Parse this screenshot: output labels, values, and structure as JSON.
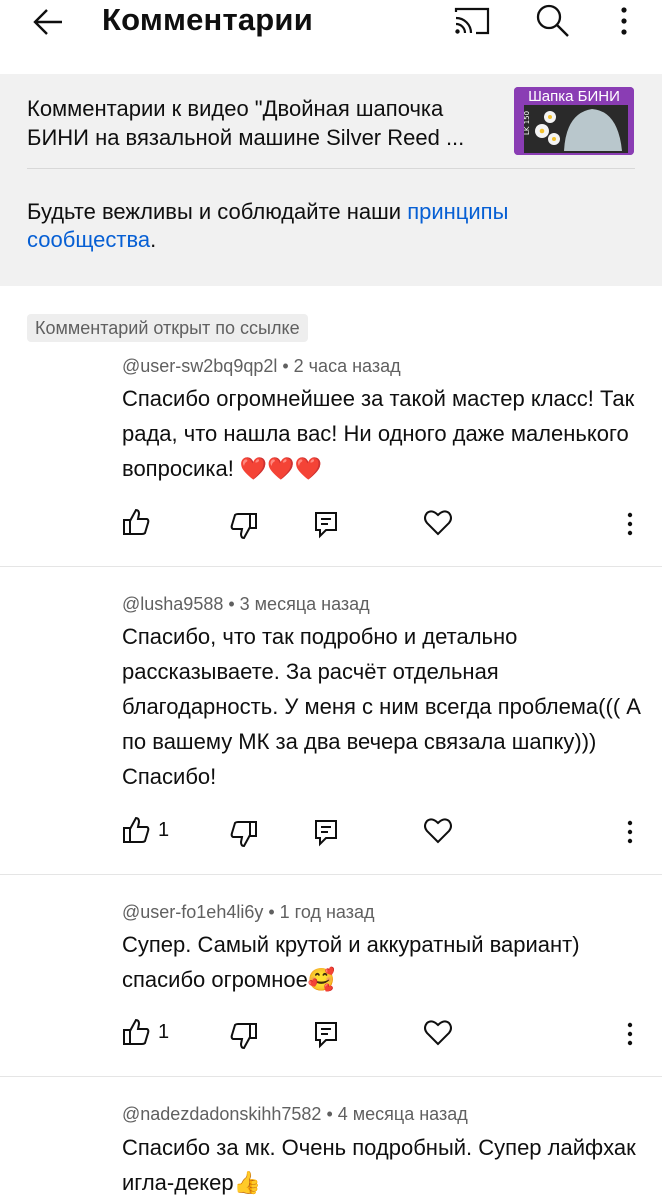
{
  "topbar": {
    "title": "Комментарии",
    "icons": [
      "arrow-back-icon",
      "cast-icon",
      "search-icon",
      "more-vertical-icon"
    ]
  },
  "video": {
    "title": "Комментарии к видео \"Двойная шапочка БИНИ на вязальной машине Silver Reed ...",
    "thumb_label": "Шапка БИНИ",
    "thumb_side_text": "LK 150"
  },
  "rules": {
    "prefix": "Будьте вежливы и соблюдайте наши ",
    "link": "принципы сообщества",
    "suffix": "."
  },
  "pill": "Комментарий открыт по ссылке",
  "comments": [
    {
      "author": "@user-sw2bq9qp2l",
      "time": "2 часа назад",
      "text": "Спасибо огромнейшее за такой мастер класс! Так рада, что нашла вас! Ни одного даже маленького вопросика! ❤️❤️❤️",
      "likes": ""
    },
    {
      "author": "@lusha9588",
      "time": "3 месяца назад",
      "text": "Спасибо, что так подробно и детально рассказываете. За расчёт отдельная благодарность. У меня с ним всегда проблема((( А по вашему МК за два вечера связала шапку))) Спасибо!",
      "likes": "1"
    },
    {
      "author": "@user-fo1eh4li6y",
      "time": "1 год назад",
      "text": "Супер. Самый крутой и аккуратный вариант) спасибо огромное🥰",
      "likes": "1"
    },
    {
      "author": "@nadezdadonskihh7582",
      "time": "4 месяца назад",
      "text": "Спасибо за мк. Очень подробный. Супер лайфхак игла-декер👍",
      "likes": ""
    }
  ],
  "colors": {
    "link": "#065fd4",
    "header_bg": "#f1f1f1",
    "meta": "#606060"
  }
}
